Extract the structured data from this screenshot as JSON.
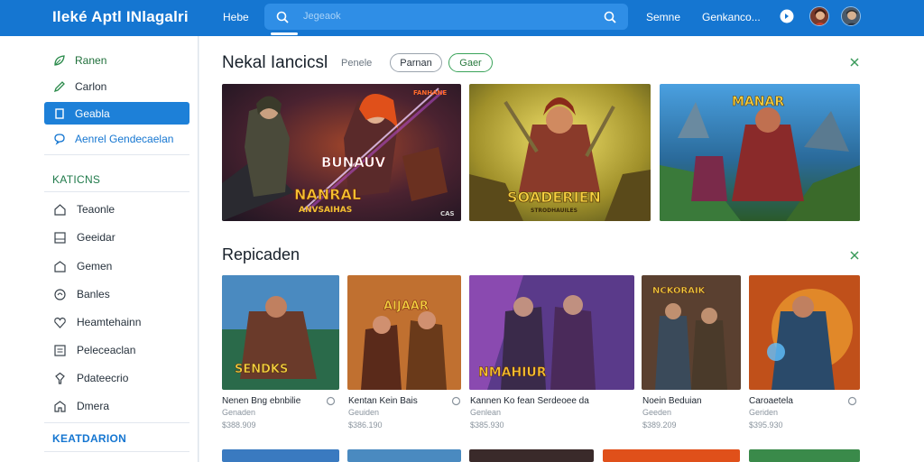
{
  "header": {
    "brand": "Ileké Aptl INlagalri",
    "home": "Hebe",
    "search_placeholder": "Jegeaok",
    "link_1": "Semne",
    "link_2": "Genkanco...",
    "icons": [
      "search-icon",
      "bell-icon",
      "avatar",
      "avatar"
    ]
  },
  "sidebar": {
    "nav": [
      {
        "label": "Ranen",
        "icon": "leaf-icon"
      },
      {
        "label": "Carlon",
        "icon": "pen-icon"
      },
      {
        "label": "Geabla",
        "icon": "square-icon"
      },
      {
        "label": "Aenrel Gendecaelan",
        "icon": "chat-icon"
      }
    ],
    "section_1": "KATICNS",
    "categories": [
      {
        "label": "Teaonle",
        "icon": "home-icon"
      },
      {
        "label": "Geeidar",
        "icon": "square-icon"
      },
      {
        "label": "Gemen",
        "icon": "house-icon"
      },
      {
        "label": "Banles",
        "icon": "circle-icon"
      },
      {
        "label": "Heamtehainn",
        "icon": "heart-icon"
      },
      {
        "label": "Peleceaclan",
        "icon": "list-icon"
      },
      {
        "label": "Pdateecrio",
        "icon": "bulb-icon"
      },
      {
        "label": "Dmera",
        "icon": "home-icon"
      }
    ],
    "section_2": "KEATDARION"
  },
  "featured": {
    "title": "Nekal Iancicsl",
    "subtitle": "Penele",
    "chip_1": "Parnan",
    "chip_2": "Gaer",
    "tiles": [
      {
        "label_1": "BUNAUV",
        "label_2": "NANRAL",
        "label_3": "ANVSAIHAS",
        "badge": "FANHANE",
        "corner": "CAS"
      },
      {
        "label_1": "SOADERIEN",
        "label_2": "STRODHAUILES"
      },
      {
        "label_1": "MANAR"
      }
    ]
  },
  "recommended": {
    "title": "Repicaden",
    "cards": [
      {
        "title": "Nenen Bng ebnbilie",
        "sub": "Genaden",
        "price": "$388.909",
        "tile_label": "SENDKS"
      },
      {
        "title": "Kentan Kein Bais",
        "sub": "Geuiden",
        "price": "$386.190",
        "tile_label": "AIJAAR"
      },
      {
        "title": "Kannen Ko fean Serdeoee da",
        "sub": "Genlean",
        "price": "$385.930",
        "tile_label": "NMAHIUR"
      },
      {
        "title": "Noein Beduian",
        "sub": "Geeden",
        "price": "$389.209",
        "tile_label": "NCKORAIK"
      },
      {
        "title": "Caroaetela",
        "sub": "Geriden",
        "price": "$395.930",
        "tile_label": ""
      }
    ]
  },
  "colors": {
    "header": "#1576d1",
    "active": "#1d80d8",
    "green_accent": "#2a7a3f"
  }
}
